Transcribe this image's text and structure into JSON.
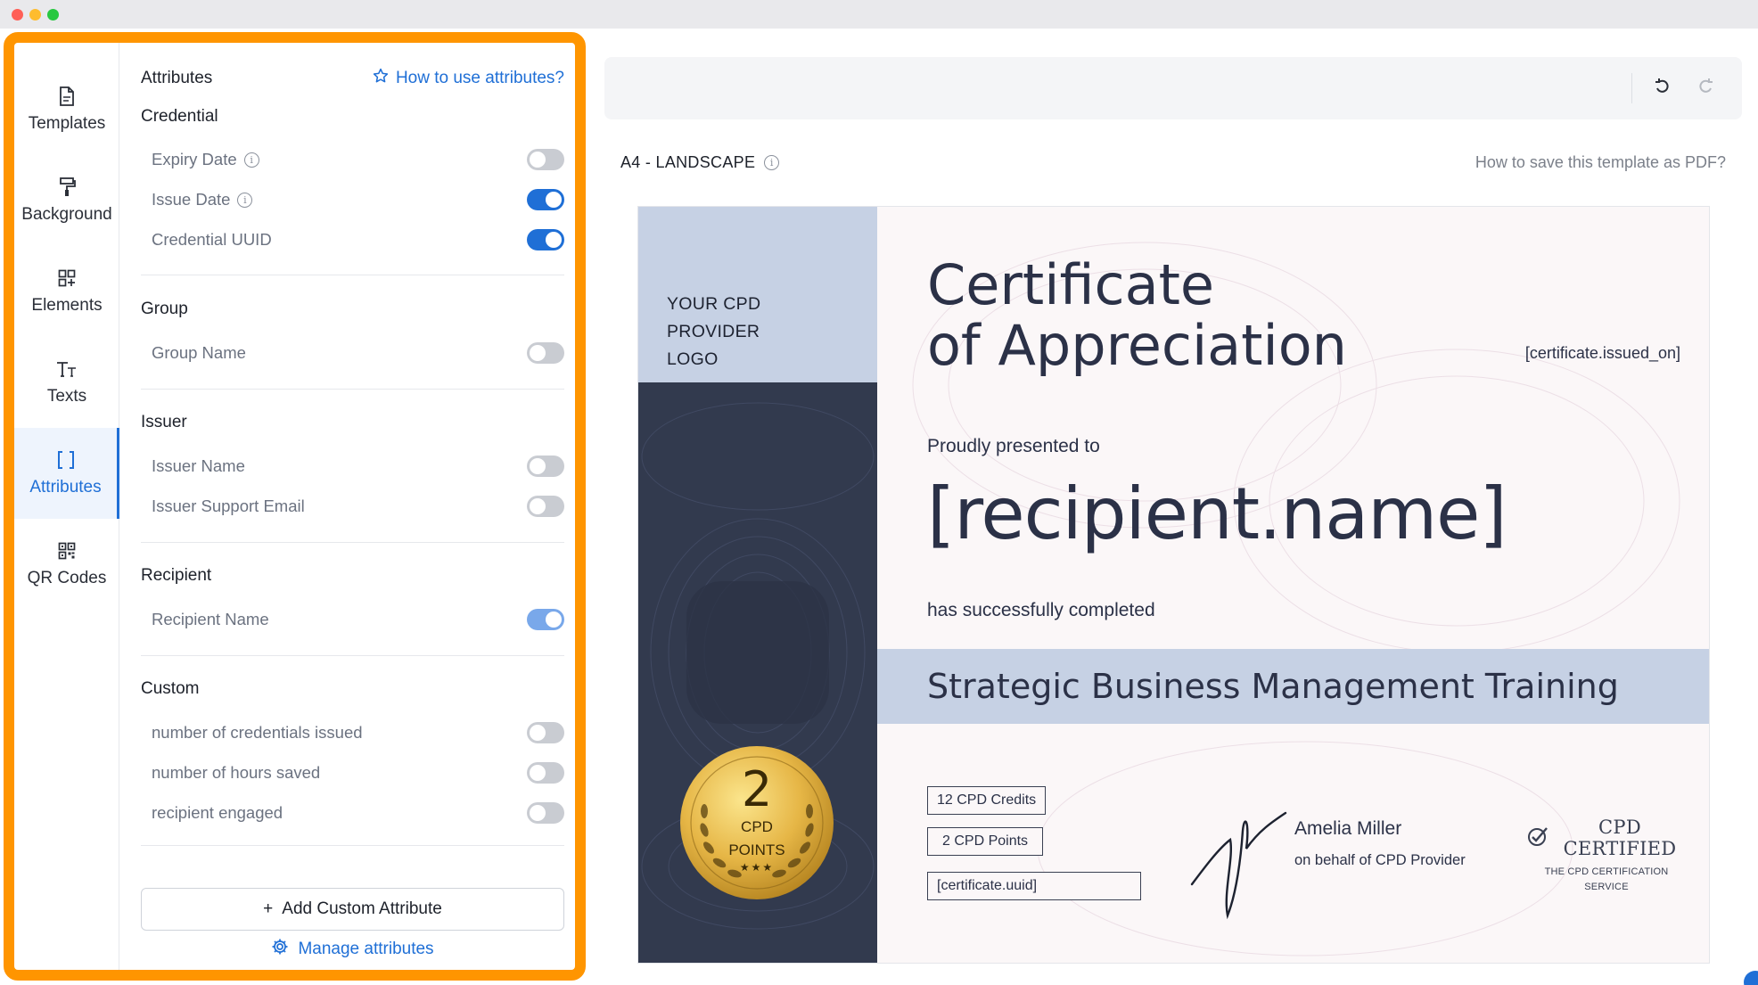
{
  "sidebar": {
    "items": [
      {
        "label": "Templates",
        "icon": "file-icon"
      },
      {
        "label": "Background",
        "icon": "paint-roller-icon"
      },
      {
        "label": "Elements",
        "icon": "grid-plus-icon"
      },
      {
        "label": "Texts",
        "icon": "text-icon"
      },
      {
        "label": "Attributes",
        "icon": "brackets-icon"
      },
      {
        "label": "QR Codes",
        "icon": "qr-code-icon"
      }
    ],
    "active": "Attributes"
  },
  "attributes": {
    "title": "Attributes",
    "help_link": "How to use attributes?",
    "sections": {
      "credential": {
        "title": "Credential",
        "items": [
          {
            "label": "Expiry Date",
            "on": false
          },
          {
            "label": "Issue Date",
            "on": true
          },
          {
            "label": "Credential UUID",
            "on": true
          }
        ]
      },
      "group": {
        "title": "Group",
        "items": [
          {
            "label": "Group Name",
            "on": false
          }
        ]
      },
      "issuer": {
        "title": "Issuer",
        "items": [
          {
            "label": "Issuer Name",
            "on": false
          },
          {
            "label": "Issuer Support Email",
            "on": false
          }
        ]
      },
      "recipient": {
        "title": "Recipient",
        "items": [
          {
            "label": "Recipient Name",
            "on": true
          }
        ]
      },
      "custom": {
        "title": "Custom",
        "items": [
          {
            "label": "number of credentials issued",
            "on": false
          },
          {
            "label": "number of hours saved",
            "on": false
          },
          {
            "label": "recipient engaged",
            "on": false
          }
        ]
      }
    },
    "add_button": "Add Custom Attribute",
    "add_button_prefix": "+",
    "manage_link": "Manage attributes"
  },
  "canvas": {
    "format": "A4 - LANDSCAPE",
    "pdf_help": "How to save this template as PDF?"
  },
  "certificate": {
    "logo_lines": [
      "YOUR CPD",
      "PROVIDER",
      "LOGO"
    ],
    "title_line1": "Certificate",
    "title_line2": "of Appreciation",
    "issued_on": "[certificate.issued_on]",
    "presented": "Proudly presented to",
    "recipient": "[recipient.name]",
    "completed": "has successfully completed",
    "course": "Strategic Business Management Training",
    "credits": [
      "12 CPD Credits",
      "2 CPD Points",
      "[certificate.uuid]"
    ],
    "signer_name": "Amelia Miller",
    "signer_role": "on behalf of CPD Provider",
    "certified_title": "CPD CERTIFIED",
    "certified_sub_1": "THE CPD CERTIFICATION",
    "certified_sub_2": "SERVICE",
    "badge_number": "2",
    "badge_line1": "CPD",
    "badge_line2": "POINTS",
    "badge_stars": "★★★"
  },
  "colors": {
    "accent": "#1f6fd6",
    "highlight_frame": "#ff9500",
    "cert_dark": "#323a4e",
    "cert_band": "#c6d1e4"
  }
}
